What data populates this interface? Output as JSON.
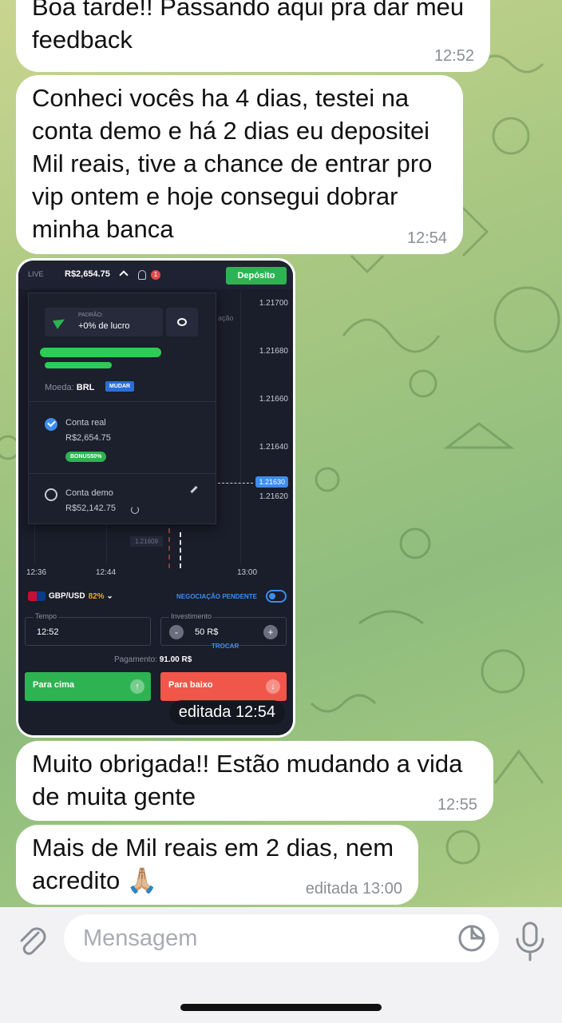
{
  "messages": [
    {
      "text": "Boa tarde!! Passando aqui pra dar meu\nfeedback",
      "time": "12:52"
    },
    {
      "text": "Conheci vocês ha 4 dias, testei na\nconta demo e há 2 dias eu depositei\nMil reais, tive a chance de entrar pro\nvip ontem e hoje consegui dobrar\nminha banca",
      "time": "12:54"
    },
    {
      "text": "Muito obrigada!! Estão mudando a vida\nde muita gente",
      "time": "12:55"
    },
    {
      "text": "Mais de Mil reais em 2 dias, nem\nacredito 🙏🏼",
      "time": "editada 13:00"
    }
  ],
  "screenshot": {
    "edited_time": "editada 12:54",
    "live_label": "LIVE",
    "balance": "R$2,654.75",
    "notification_count": "1",
    "deposit": "Depósito",
    "prices": [
      "1.21700",
      "1.21680",
      "1.21660",
      "1.21640",
      "1.21620"
    ],
    "current_price": "1.21630",
    "ghost_price": "1.21609",
    "partial_label": "ação",
    "times": [
      "12:36",
      "12:44",
      "13:00"
    ],
    "panel": {
      "pad_label": "PADRÃO:",
      "pad_value": "+0% de lucro",
      "moeda_label": "Moeda:",
      "moeda_value": "BRL",
      "mudar": "MUDAR",
      "real_label": "Conta real",
      "real_value": "R$2,654.75",
      "bonus": "BONUS50%",
      "demo_label": "Conta demo",
      "demo_value": "R$52,142.75"
    },
    "pair": "GBP/USD",
    "pair_pct": "82%",
    "pending": "NEGOCIAÇÃO PENDENTE",
    "tempo_label": "Tempo",
    "tempo_value": "12:52",
    "invest_label": "Investimento",
    "invest_value": "50 R$",
    "trocar": "TROCAR",
    "pagamento_label": "Pagamento:",
    "pagamento_value": "91.00 R$",
    "up": "Para cima",
    "down": "Para baixo"
  },
  "input": {
    "placeholder": "Mensagem"
  }
}
